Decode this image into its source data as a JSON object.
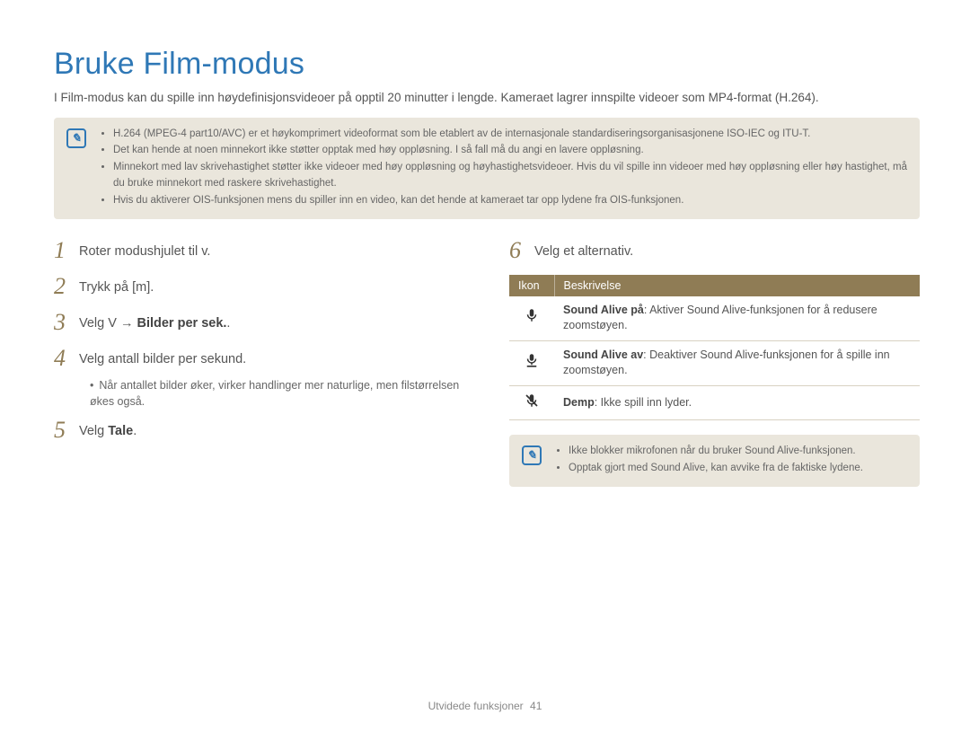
{
  "title": "Bruke Film-modus",
  "intro": "I Film-modus kan du spille inn høydefinisjonsvideoer på opptil 20 minutter i lengde. Kameraet lagrer innspilte videoer som MP4-format (H.264).",
  "top_notes": [
    "H.264 (MPEG-4 part10/AVC) er et høykomprimert videoformat som ble etablert av de internasjonale standardiseringsorganisasjonene ISO-IEC og ITU-T.",
    "Det kan hende at noen minnekort ikke støtter opptak med høy oppløsning. I så fall må du angi en lavere oppløsning.",
    "Minnekort med lav skrivehastighet støtter ikke videoer med høy oppløsning og høyhastighetsvideoer. Hvis du vil spille inn videoer med høy oppløsning eller høy hastighet, må du bruke minnekort med raskere skrivehastighet.",
    "Hvis du aktiverer OIS-funksjonen mens du spiller inn en video, kan det hende at kameraet tar opp lydene fra OIS-funksjonen."
  ],
  "steps_left": [
    {
      "num": "1",
      "prefix": "Roter modushjulet til ",
      "icon": "v",
      "suffix": "."
    },
    {
      "num": "2",
      "prefix": "Trykk på [",
      "icon": "m",
      "suffix": "]."
    },
    {
      "num": "3",
      "prefix": "Velg ",
      "icon": "V",
      "mid": " → ",
      "bold": "Bilder per sek.",
      "suffix": "."
    },
    {
      "num": "4",
      "prefix": "Velg antall bilder per sekund.",
      "sub": "Når antallet bilder øker, virker handlinger mer naturlige, men filstørrelsen økes også."
    },
    {
      "num": "5",
      "prefix": "Velg ",
      "bold": "Tale",
      "suffix": "."
    }
  ],
  "steps_right": [
    {
      "num": "6",
      "prefix": "Velg et alternativ."
    }
  ],
  "table": {
    "headers": {
      "icon": "Ikon",
      "desc": "Beskrivelse"
    },
    "rows": [
      {
        "icon": "mic-on",
        "title": "Sound Alive på",
        "desc": ": Aktiver Sound Alive-funksjonen for å redusere zoomstøyen."
      },
      {
        "icon": "mic-off-bar",
        "title": "Sound Alive av",
        "desc": ": Deaktiver Sound Alive-funksjonen for å spille inn zoomstøyen."
      },
      {
        "icon": "mic-mute",
        "title": "Demp",
        "desc": ": Ikke spill inn lyder."
      }
    ]
  },
  "bottom_notes": [
    "Ikke blokker mikrofonen når du bruker Sound Alive-funksjonen.",
    "Opptak gjort med Sound Alive, kan avvike fra de faktiske lydene."
  ],
  "footer": {
    "section": "Utvidede funksjoner",
    "page": "41"
  }
}
